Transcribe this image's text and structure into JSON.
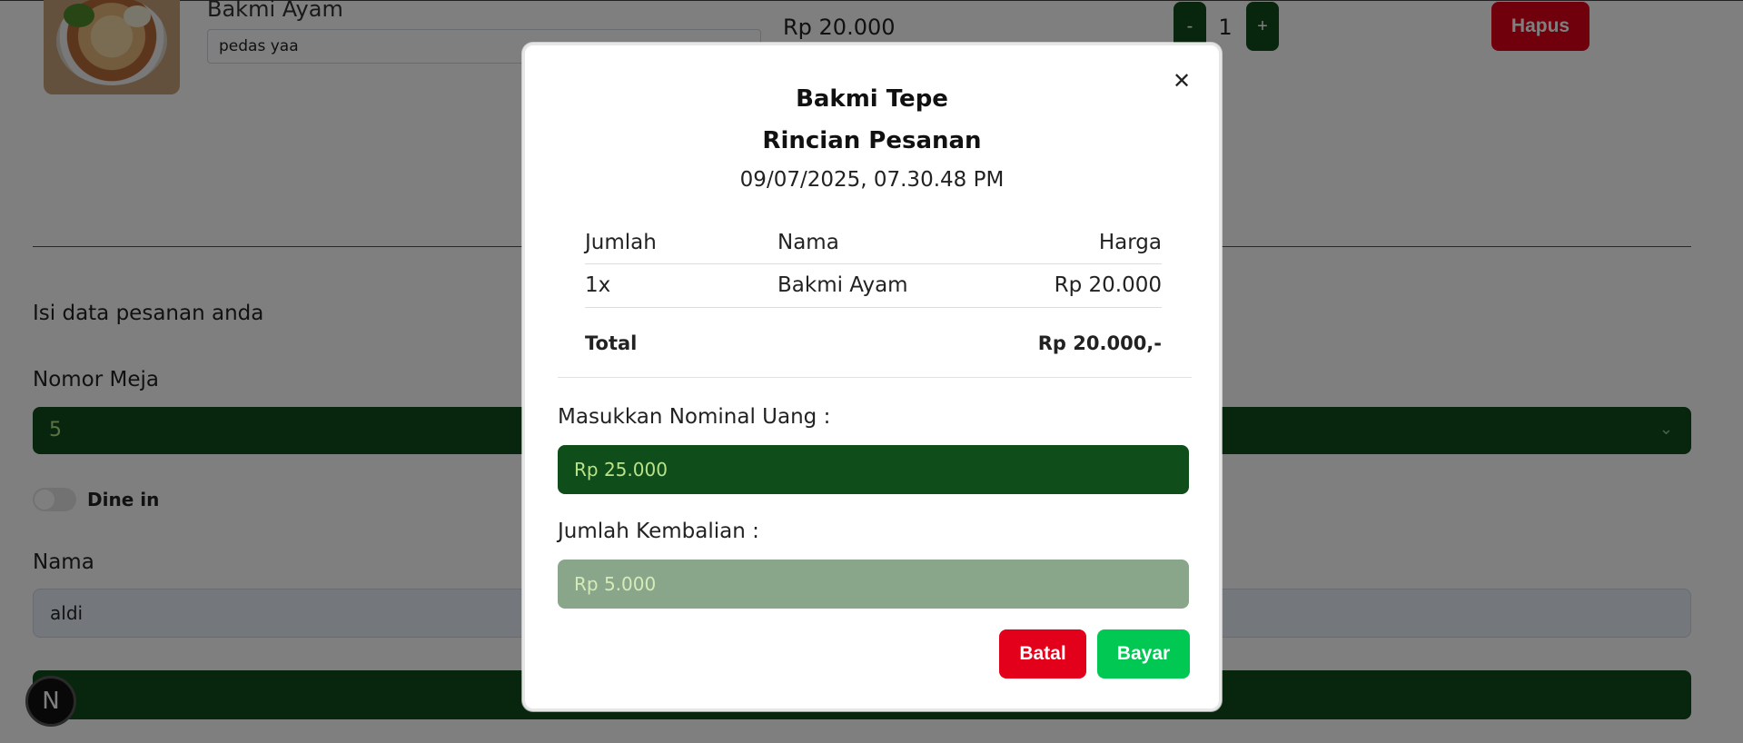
{
  "cart": {
    "item_name": "Bakmi Ayam",
    "note": "pedas yaa",
    "price": "Rp 20.000",
    "minus_label": "-",
    "quantity": "1",
    "plus_label": "+",
    "delete_label": "Hapus"
  },
  "form": {
    "heading": "Isi data pesanan anda",
    "table_label": "Nomor Meja",
    "table_value": "5",
    "dine_in_label": "Dine in",
    "name_label": "Nama",
    "name_value": "aldi"
  },
  "badge": {
    "label": "N"
  },
  "modal": {
    "shop_name": "Bakmi Tepe",
    "title": "Rincian Pesanan",
    "date": "09/07/2025, 07.30.48 PM",
    "close_label": "✕",
    "columns": {
      "qty": "Jumlah",
      "name": "Nama",
      "price": "Harga"
    },
    "items": [
      {
        "qty": "1x",
        "name": "Bakmi Ayam",
        "price": "Rp 20.000"
      }
    ],
    "total_label": "Total",
    "total_value": "Rp 20.000,-",
    "nominal_label": "Masukkan Nominal Uang :",
    "nominal_value": "Rp 25.000",
    "change_label": "Jumlah Kembalian :",
    "change_value": "Rp 5.000",
    "cancel_label": "Batal",
    "pay_label": "Bayar"
  },
  "colors": {
    "primary_green": "#0f4d1a",
    "danger_red": "#e2001a",
    "success_green": "#00c853"
  }
}
